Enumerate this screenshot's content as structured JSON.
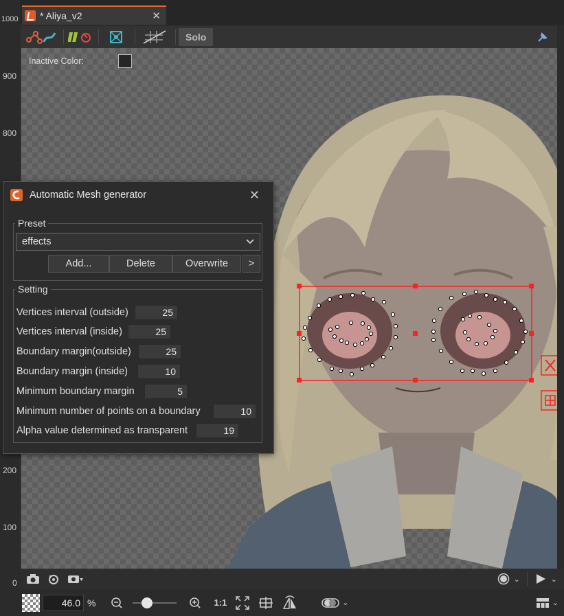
{
  "ruler": {
    "ticks": [
      "1000",
      "900",
      "800",
      "200",
      "100",
      "0"
    ]
  },
  "document_tab": {
    "title": "* Aliya_v2",
    "close_glyph": "✕"
  },
  "toolbar": {
    "solo_label": "Solo"
  },
  "canvas": {
    "inactive_color_label": "Inactive Color:"
  },
  "dialog": {
    "title": "Automatic Mesh generator",
    "preset": {
      "group_label": "Preset",
      "selected": "effects",
      "add_label": "Add...",
      "delete_label": "Delete",
      "overwrite_label": "Overwrite",
      "more_label": ">"
    },
    "setting": {
      "group_label": "Setting",
      "rows": [
        {
          "label": "Vertices interval (outside)",
          "value": "25"
        },
        {
          "label": "Vertices interval (inside)",
          "value": "25"
        },
        {
          "label": "Boundary margin(outside)",
          "value": "25"
        },
        {
          "label": "Boundary margin (inside)",
          "value": "10"
        },
        {
          "label": "Minimum boundary margin",
          "value": "5"
        },
        {
          "label": "Minimum number of points on a boundary",
          "value": "10"
        },
        {
          "label": "Alpha value determined as transparent",
          "value": "19"
        }
      ]
    }
  },
  "status": {
    "zoom_value": "46.0",
    "zoom_unit": "%",
    "zoom_level_fraction": 0.2,
    "one_to_one_label": "1:1"
  },
  "colors": {
    "accent": "#e0642a",
    "selection": "#ff2020",
    "panel": "#2c2c2c"
  }
}
